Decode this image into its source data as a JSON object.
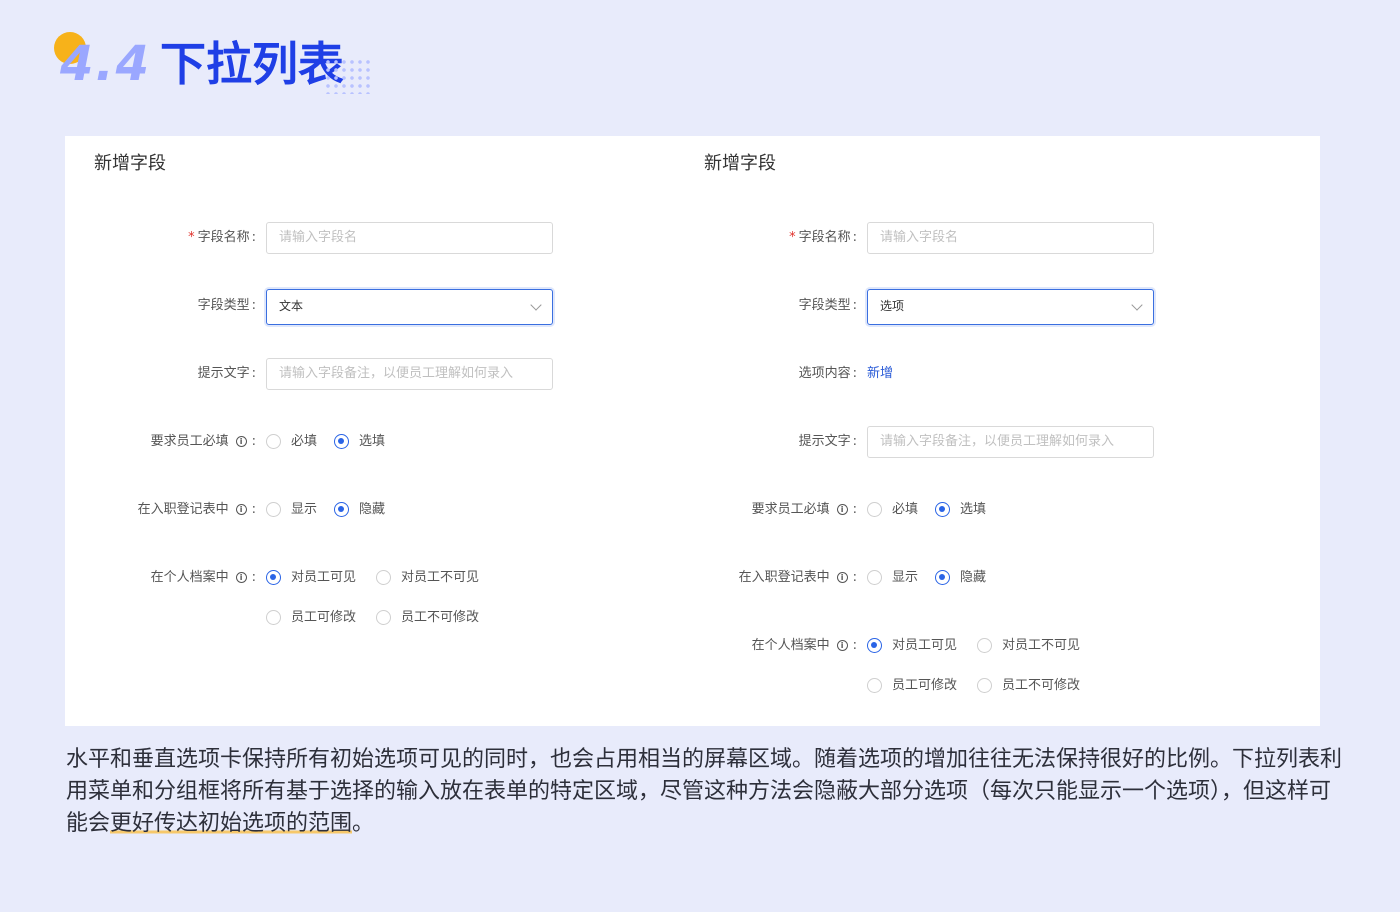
{
  "title": {
    "number": "4.4",
    "text": "下拉列表"
  },
  "left_panel": {
    "title": "新增字段",
    "field_name": {
      "required_mark": "*",
      "label": "字段名称",
      "placeholder": "请输入字段名"
    },
    "field_type": {
      "label": "字段类型",
      "value": "文本"
    },
    "hint_text": {
      "label": "提示文字",
      "placeholder": "请输入字段备注，以便员工理解如何录入"
    },
    "require_fill": {
      "label": "要求员工必填",
      "options": [
        {
          "label": "必填",
          "selected": false
        },
        {
          "label": "选填",
          "selected": true
        }
      ]
    },
    "onboarding_form": {
      "label": "在入职登记表中",
      "options": [
        {
          "label": "显示",
          "selected": false
        },
        {
          "label": "隐藏",
          "selected": true
        }
      ]
    },
    "profile": {
      "label": "在个人档案中",
      "options": [
        {
          "label": "对员工可见",
          "selected": true
        },
        {
          "label": "对员工不可见",
          "selected": false
        },
        {
          "label": "员工可修改",
          "selected": false
        },
        {
          "label": "员工不可修改",
          "selected": false
        }
      ]
    }
  },
  "right_panel": {
    "title": "新增字段",
    "field_name": {
      "required_mark": "*",
      "label": "字段名称",
      "placeholder": "请输入字段名"
    },
    "field_type": {
      "label": "字段类型",
      "value": "选项"
    },
    "option_content": {
      "label": "选项内容",
      "link": "新增"
    },
    "hint_text": {
      "label": "提示文字",
      "placeholder": "请输入字段备注，以便员工理解如何录入"
    },
    "require_fill": {
      "label": "要求员工必填",
      "options": [
        {
          "label": "必填",
          "selected": false
        },
        {
          "label": "选填",
          "selected": true
        }
      ]
    },
    "onboarding_form": {
      "label": "在入职登记表中",
      "options": [
        {
          "label": "显示",
          "selected": false
        },
        {
          "label": "隐藏",
          "selected": true
        }
      ]
    },
    "profile": {
      "label": "在个人档案中",
      "options": [
        {
          "label": "对员工可见",
          "selected": true
        },
        {
          "label": "对员工不可见",
          "selected": false
        },
        {
          "label": "员工可修改",
          "selected": false
        },
        {
          "label": "员工不可修改",
          "selected": false
        }
      ]
    }
  },
  "paragraph": {
    "part1": "水平和垂直选项卡保持所有初始选项可见的同时，也会占用相当的屏幕区域。随着选项的增加往往无法保持很好的比例。下拉列表利用菜单和分组框将所有基于选择的输入放在表单的特定区域，尽管这种方法会隐蔽大部分选项（每次只能显示一个选项），但这样可能会",
    "highlight": "更好传达初始选项的范围",
    "part2": "。"
  },
  "colors": {
    "accent": "#2a64e6",
    "title_blue": "#1f3fe6",
    "background": "#e8ebfb",
    "title_dot": "#f7b21a"
  }
}
